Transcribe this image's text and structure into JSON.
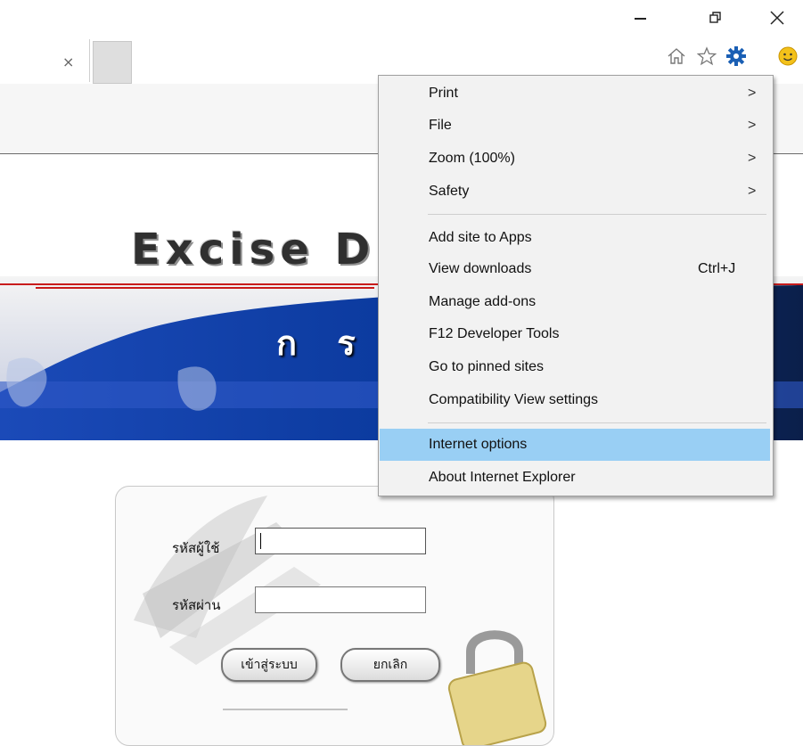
{
  "window": {
    "controls": {
      "minimize": "minimize",
      "restore": "restore",
      "close": "close"
    }
  },
  "tab": {
    "close_glyph": "×"
  },
  "toolbar_icons": [
    "home-icon",
    "star-icon",
    "gear-icon",
    "smiley-icon"
  ],
  "page": {
    "banner_title": "Excise D",
    "banner_thai": "ก ร ม",
    "login": {
      "username_label": "รหัสผู้ใช้",
      "password_label": "รหัสผ่าน",
      "username_value": "",
      "password_value": "",
      "login_button": "เข้าสู่ระบบ",
      "cancel_button": "ยกเลิก"
    }
  },
  "menu": {
    "items": [
      {
        "label": "Print",
        "submenu": true
      },
      {
        "label": "File",
        "submenu": true
      },
      {
        "label": "Zoom (100%)",
        "submenu": true
      },
      {
        "label": "Safety",
        "submenu": true
      },
      {
        "label": "Add site to Apps"
      },
      {
        "label": "View downloads",
        "shortcut": "Ctrl+J"
      },
      {
        "label": "Manage add-ons"
      },
      {
        "label": "F12 Developer Tools"
      },
      {
        "label": "Go to pinned sites"
      },
      {
        "label": "Compatibility View settings"
      },
      {
        "label": "Internet options",
        "highlighted": true
      },
      {
        "label": "About Internet Explorer"
      }
    ],
    "arrow_glyph": ">"
  },
  "colors": {
    "menu_highlight": "#99cff4",
    "banner_blue": "#0b3a9e",
    "banner_dark": "#0b1f4a",
    "gear_blue": "#1a5fb4",
    "smiley_yellow": "#f3c11a"
  }
}
